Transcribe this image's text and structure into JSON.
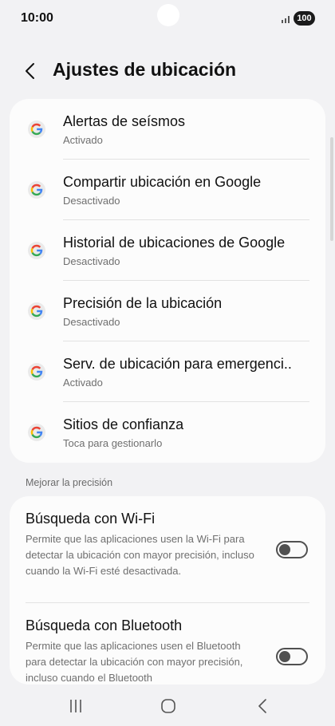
{
  "status_bar": {
    "time": "10:00",
    "battery": "100"
  },
  "header": {
    "title": "Ajustes de ubicación"
  },
  "google_items": [
    {
      "title": "Alertas de seísmos",
      "subtitle": "Activado"
    },
    {
      "title": "Compartir ubicación en Google",
      "subtitle": "Desactivado"
    },
    {
      "title": "Historial de ubicaciones de Google",
      "subtitle": "Desactivado"
    },
    {
      "title": "Precisión de la ubicación",
      "subtitle": "Desactivado"
    },
    {
      "title": "Serv. de ubicación para emergenci..",
      "subtitle": "Activado"
    },
    {
      "title": "Sitios de confianza",
      "subtitle": "Toca para gestionarlo"
    }
  ],
  "section": {
    "label": "Mejorar la precisión"
  },
  "scan_items": [
    {
      "title": "Búsqueda con Wi-Fi",
      "description": "Permite que las aplicaciones usen la Wi-Fi para detectar la ubicación con mayor precisión, incluso cuando la Wi-Fi esté desactivada.",
      "enabled": false
    },
    {
      "title": "Búsqueda con Bluetooth",
      "description": "Permite que las aplicaciones usen el Bluetooth para detectar la ubicación con mayor precisión, incluso cuando el Bluetooth",
      "enabled": false
    }
  ],
  "icons": {
    "google": "google-icon",
    "back": "back-arrow-icon",
    "recents": "recents-icon",
    "home": "home-icon",
    "nav_back": "nav-back-icon"
  },
  "colors": {
    "background": "#f2f2f4",
    "card": "#fcfcfc",
    "google_blue": "#4285F4",
    "google_red": "#EA4335",
    "google_yellow": "#FBBC05",
    "google_green": "#34A853"
  }
}
